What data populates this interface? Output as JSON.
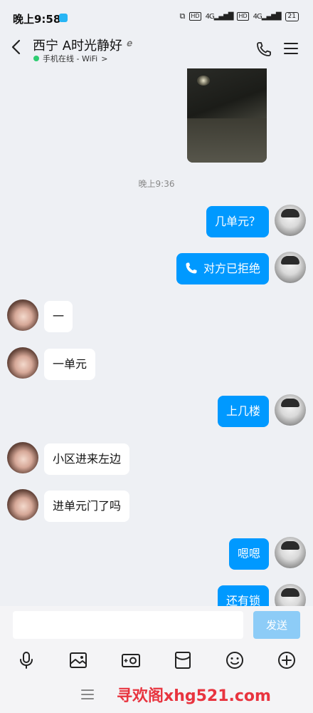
{
  "status": {
    "time": "晚上9:58",
    "hd1": "HD",
    "net1": "4G",
    "hd2": "HD",
    "net2": "4G",
    "battery": "21"
  },
  "header": {
    "title": "西宁 A时光静好",
    "status": "手机在线 - WiFi",
    "status_chevron": ">"
  },
  "chat": {
    "timestamp": "晚上9:36",
    "messages": [
      {
        "side": "out",
        "text": "几单元？"
      },
      {
        "side": "out",
        "text": "对方已拒绝",
        "type": "call"
      },
      {
        "side": "in",
        "text": "一"
      },
      {
        "side": "in",
        "text": "一单元"
      },
      {
        "side": "out",
        "text": "上几楼"
      },
      {
        "side": "in",
        "text": "小区进来左边"
      },
      {
        "side": "in",
        "text": "进单元门了吗"
      },
      {
        "side": "out",
        "text": "嗯嗯"
      },
      {
        "side": "out",
        "text": "还有锁"
      }
    ]
  },
  "composer": {
    "input_value": "",
    "send_label": "发送"
  },
  "toolbar": [
    "mic-icon",
    "image-icon",
    "camera-icon",
    "red-packet-icon",
    "emoji-icon",
    "plus-icon"
  ],
  "watermark": "寻欢阁xhg521.com",
  "colors": {
    "accent": "#0099ff",
    "send_disabled": "#8dccf7",
    "background": "#eef0f4",
    "online": "#2ecc71",
    "watermark": "#e8343f"
  }
}
